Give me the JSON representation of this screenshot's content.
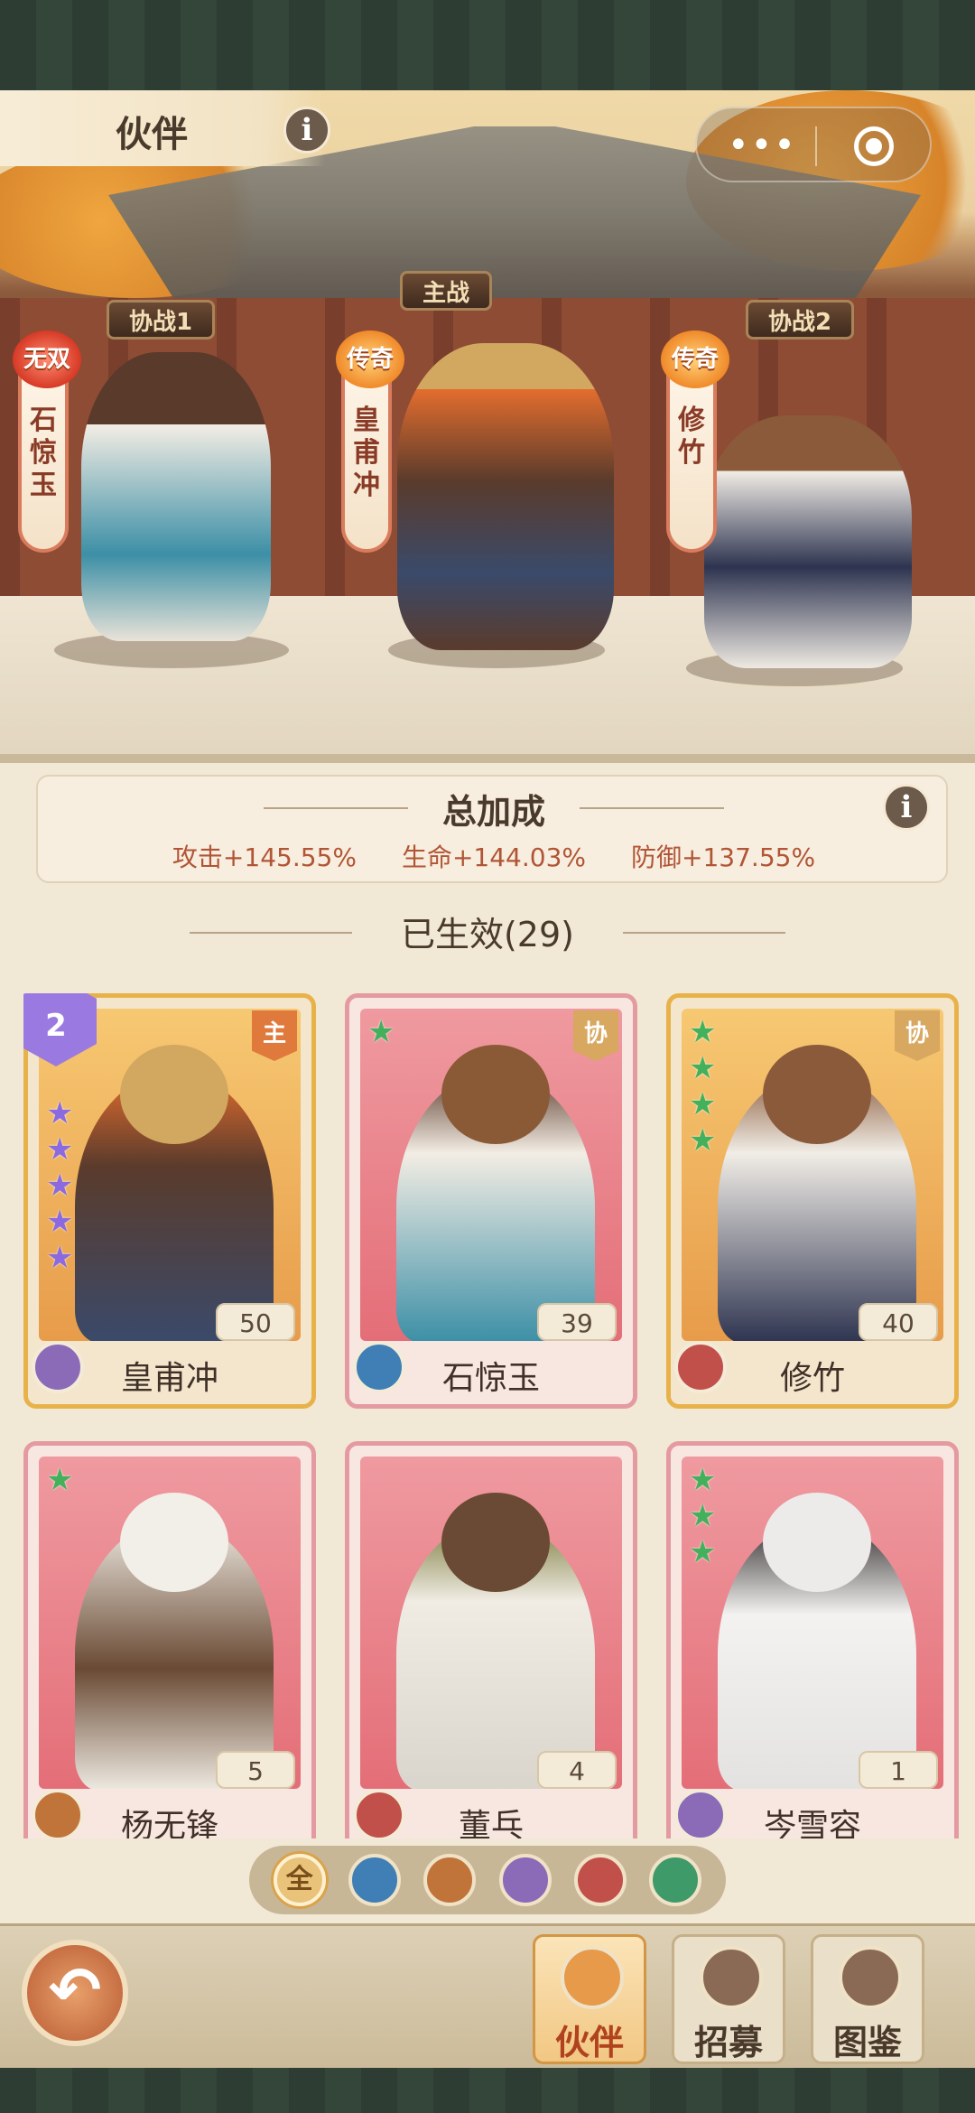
{
  "header": {
    "title": "伙伴",
    "info_icon": "info-icon",
    "menu_icon": "more-dots-icon",
    "record_icon": "record-icon"
  },
  "stage": {
    "signs": {
      "main": "主战",
      "assist1": "协战1",
      "assist2": "协战2"
    },
    "heroes": [
      {
        "badge": "无双",
        "name": "石惊玉",
        "badge_color": "#d73a26"
      },
      {
        "badge": "传奇",
        "name": "皇甫冲",
        "badge_color": "#f08a2a"
      },
      {
        "badge": "传奇",
        "name": "修竹",
        "badge_color": "#f08a2a"
      }
    ]
  },
  "bonus": {
    "title": "总加成",
    "values": [
      "攻击+145.55%",
      "生命+144.03%",
      "防御+137.55%"
    ]
  },
  "effective": {
    "label": "已生效(29)"
  },
  "cards": [
    {
      "name": "皇甫冲",
      "level": "50",
      "tag": "主",
      "stars": 5,
      "star_color": "purple",
      "rank": "2",
      "frame": "gold",
      "element": "#8b6ab8"
    },
    {
      "name": "石惊玉",
      "level": "39",
      "tag": "协",
      "stars": 1,
      "star_color": "green",
      "frame": "red",
      "element": "#3f7fb5"
    },
    {
      "name": "修竹",
      "level": "40",
      "tag": "协",
      "stars": 4,
      "star_color": "green",
      "frame": "gold",
      "element": "#c2504a"
    },
    {
      "name": "杨无锋",
      "level": "5",
      "stars": 1,
      "star_color": "green",
      "frame": "red",
      "element": "#c0743a"
    },
    {
      "name": "董乓",
      "level": "4",
      "stars": 0,
      "star_color": "green",
      "frame": "red",
      "element": "#c2504a"
    },
    {
      "name": "岑雪容",
      "level": "1",
      "stars": 3,
      "star_color": "green",
      "frame": "red",
      "element": "#8b6ab8"
    }
  ],
  "filters": {
    "all": "全",
    "items": [
      {
        "icon": "water-element-icon",
        "color": "#3f7fb5"
      },
      {
        "icon": "fire-element-icon",
        "color": "#c0743a"
      },
      {
        "icon": "poison-element-icon",
        "color": "#8b6ab8"
      },
      {
        "icon": "fist-element-icon",
        "color": "#c2504a"
      },
      {
        "icon": "wind-element-icon",
        "color": "#3f9a6a"
      }
    ]
  },
  "nav": {
    "partner": "伙伴",
    "recruit": "招募",
    "codex": "图鉴"
  }
}
